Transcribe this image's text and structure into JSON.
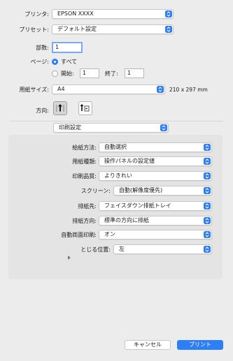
{
  "printer": {
    "label": "プリンタ:",
    "value": "EPSON XXXX"
  },
  "preset": {
    "label": "プリセット:",
    "value": "デフォルト設定"
  },
  "copies": {
    "label": "部数:",
    "value": "1"
  },
  "pages": {
    "label": "ページ:",
    "all_label": "すべて",
    "from_label": "開始:",
    "from_value": "1",
    "to_label": "終了:",
    "to_value": "1"
  },
  "paper_size": {
    "label": "用紙サイズ:",
    "value": "A4",
    "dimensions": "210 x 297 mm"
  },
  "orientation": {
    "label": "方向:",
    "portrait_icon": "portrait-orientation-icon",
    "landscape_icon": "landscape-orientation-icon"
  },
  "section": {
    "value": "印刷設定"
  },
  "settings": [
    {
      "label": "給紙方法:",
      "value": "自動選択"
    },
    {
      "label": "用紙種類:",
      "value": "操作パネルの設定値"
    },
    {
      "label": "印刷品質:",
      "value": "よりきれい"
    },
    {
      "label": "スクリーン:",
      "value": "自動(解像度優先)"
    },
    {
      "label": "排紙先:",
      "value": "フェイスダウン排紙トレイ"
    },
    {
      "label": "排紙方向:",
      "value": "標準の方向に排紙"
    },
    {
      "label": "自動両面印刷:",
      "value": "オン"
    },
    {
      "label": "とじる位置:",
      "value": "左"
    }
  ],
  "disclosure_icon": "disclosure-triangle-icon",
  "footer": {
    "cancel_label": "キャンセル",
    "print_label": "プリント"
  },
  "colors": {
    "accent": "#2d7ef7",
    "background": "#ececec"
  }
}
